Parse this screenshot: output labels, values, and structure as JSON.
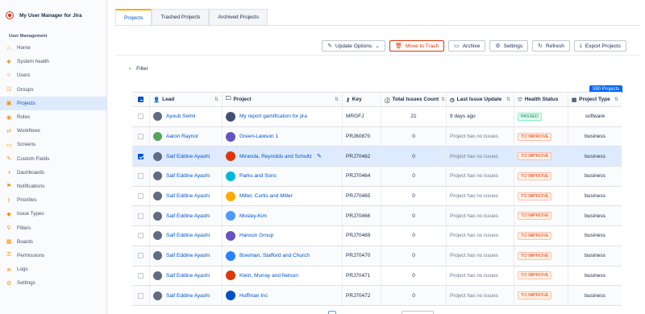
{
  "app": {
    "title": "My User Manager for Jira"
  },
  "sidebar": {
    "section_title": "User Management",
    "items": [
      {
        "label": "Home",
        "icon": "home-icon"
      },
      {
        "label": "System health",
        "icon": "health-icon"
      },
      {
        "label": "Users",
        "icon": "users-icon"
      },
      {
        "label": "Groups",
        "icon": "groups-icon"
      },
      {
        "label": "Projects",
        "icon": "projects-icon",
        "active": true
      },
      {
        "label": "Roles",
        "icon": "roles-icon"
      },
      {
        "label": "Workflows",
        "icon": "workflows-icon"
      },
      {
        "label": "Screens",
        "icon": "screens-icon"
      },
      {
        "label": "Custom Fields",
        "icon": "custom-fields-icon"
      },
      {
        "label": "Dashboards",
        "icon": "dashboards-icon"
      },
      {
        "label": "Notifications",
        "icon": "notifications-icon"
      },
      {
        "label": "Priorities",
        "icon": "priorities-icon"
      },
      {
        "label": "Issue Types",
        "icon": "issue-types-icon"
      },
      {
        "label": "Filters",
        "icon": "filters-icon"
      },
      {
        "label": "Boards",
        "icon": "boards-icon"
      },
      {
        "label": "Permissions",
        "icon": "permissions-icon"
      },
      {
        "label": "Logs",
        "icon": "logs-icon"
      },
      {
        "label": "Settings",
        "icon": "settings-icon"
      }
    ]
  },
  "tabs": [
    {
      "label": "Projects",
      "active": true
    },
    {
      "label": "Trashed Projects"
    },
    {
      "label": "Archived Projects"
    }
  ],
  "toolbar": {
    "update_options": "Update Options",
    "move_to_trash": "Move to Trash",
    "archive": "Archive",
    "settings": "Settings",
    "refresh": "Refresh",
    "export_projects": "Export Projects"
  },
  "filter": {
    "label": "Filter"
  },
  "table": {
    "count_badge": "590 Projects",
    "columns": {
      "lead": "Lead",
      "project": "Project",
      "key": "Key",
      "total_issues": "Total Issues Count",
      "last_update": "Last Issue Update",
      "health": "Health Status",
      "type": "Project Type"
    },
    "rows": [
      {
        "lead": "Ayoub Selmi",
        "project": "My report gamification for jira",
        "key": "MRGFJ",
        "count": "21",
        "update": "9 days ago",
        "health": "PASSED",
        "type": "software",
        "avatar_color": "#5e6c84",
        "proj_color": "#42526e"
      },
      {
        "lead": "Aaron Raynor",
        "project": "Green-Lawson 1",
        "key": "PRJ60870",
        "count": "0",
        "update": "Project has no issues",
        "health": "TO IMPROVE",
        "type": "business",
        "avatar_color": "#57a55a",
        "proj_color": "#6554c0"
      },
      {
        "lead": "Saif Eddine Ayashi",
        "project": "Miranda, Reynolds and Schultz",
        "key": "PRJ70462",
        "count": "0",
        "update": "Project has no issues",
        "health": "TO IMPROVE",
        "type": "business",
        "avatar_color": "#5e6c84",
        "proj_color": "#de350b",
        "selected": true
      },
      {
        "lead": "Saif Eddine Ayashi",
        "project": "Parks and Sons",
        "key": "PRJ70464",
        "count": "0",
        "update": "Project has no issues",
        "health": "TO IMPROVE",
        "type": "business",
        "avatar_color": "#5e6c84",
        "proj_color": "#00b8d9"
      },
      {
        "lead": "Saif Eddine Ayashi",
        "project": "Miller, Curtis and Miller",
        "key": "PRJ70465",
        "count": "0",
        "update": "Project has no issues",
        "health": "TO IMPROVE",
        "type": "business",
        "avatar_color": "#5e6c84",
        "proj_color": "#ffab00"
      },
      {
        "lead": "Saif Eddine Ayashi",
        "project": "Mosley-Kim",
        "key": "PRJ70466",
        "count": "0",
        "update": "Project has no issues",
        "health": "TO IMPROVE",
        "type": "business",
        "avatar_color": "#5e6c84",
        "proj_color": "#4c9aff"
      },
      {
        "lead": "Saif Eddine Ayashi",
        "project": "Hanson Group",
        "key": "PRJ70469",
        "count": "0",
        "update": "Project has no issues",
        "health": "TO IMPROVE",
        "type": "business",
        "avatar_color": "#5e6c84",
        "proj_color": "#6554c0"
      },
      {
        "lead": "Saif Eddine Ayashi",
        "project": "Bowman, Stafford and Church",
        "key": "PRJ70470",
        "count": "0",
        "update": "Project has no issues",
        "health": "TO IMPROVE",
        "type": "business",
        "avatar_color": "#5e6c84",
        "proj_color": "#2684ff"
      },
      {
        "lead": "Saif Eddine Ayashi",
        "project": "Klein, Murray and Nelson",
        "key": "PRJ70471",
        "count": "0",
        "update": "Project has no issues",
        "health": "TO IMPROVE",
        "type": "business",
        "avatar_color": "#5e6c84",
        "proj_color": "#de350b"
      },
      {
        "lead": "Saif Eddine Ayashi",
        "project": "Huffman Inc",
        "key": "PRJ70472",
        "count": "0",
        "update": "Project has no issues",
        "health": "TO IMPROVE",
        "type": "business",
        "avatar_color": "#5e6c84",
        "proj_color": "#0052cc"
      }
    ]
  }
}
